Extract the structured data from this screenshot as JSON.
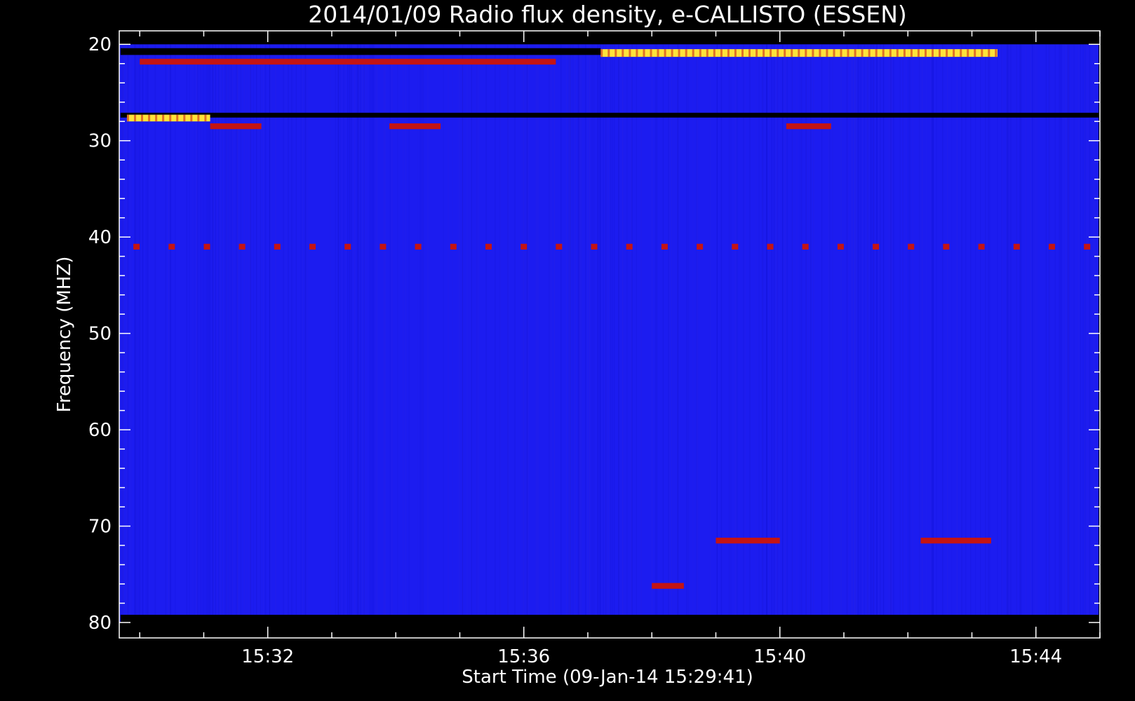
{
  "chart_data": {
    "type": "heatmap",
    "title": "2014/01/09  Radio flux density, e-CALLISTO (ESSEN)",
    "xlabel": "Start Time (09-Jan-14 15:29:41)",
    "ylabel": "Frequency (MHZ)",
    "x_ticks": [
      "15:32",
      "15:36",
      "15:40",
      "15:44"
    ],
    "x_tick_minutes": [
      32,
      36,
      40,
      44
    ],
    "x_range_minutes": [
      29.68,
      45.0
    ],
    "data_time_range_minutes": [
      29.68,
      44.98
    ],
    "y_ticks": [
      "20",
      "30",
      "40",
      "50",
      "60",
      "70",
      "80"
    ],
    "y_tick_values": [
      20,
      30,
      40,
      50,
      60,
      70,
      80
    ],
    "y_range": [
      18.6,
      81.6
    ],
    "y_reversed": true,
    "data_freq_range": [
      20,
      80
    ],
    "colors": {
      "background": "#000000",
      "axes": "#ffffff",
      "low": "#1c1cf0",
      "mid": "#c41414",
      "high": "#ffe33a",
      "dark": "#000000"
    },
    "features": [
      {
        "label": "intense emission band",
        "t0": 37.2,
        "t1": 43.4,
        "f0": 20.5,
        "f1": 21.3,
        "color": "high"
      },
      {
        "label": "emission band",
        "t0": 30.0,
        "t1": 36.5,
        "f0": 21.5,
        "f1": 22.1,
        "color": "mid"
      },
      {
        "label": "dark band",
        "t0": 29.7,
        "t1": 37.2,
        "f0": 20.4,
        "f1": 21.1,
        "color": "dark"
      },
      {
        "label": "interference band",
        "t0": 29.7,
        "t1": 45.0,
        "f0": 27.1,
        "f1": 27.6,
        "color": "dark"
      },
      {
        "label": "bright patch",
        "t0": 29.8,
        "t1": 31.1,
        "f0": 27.3,
        "f1": 28.0,
        "color": "high"
      },
      {
        "label": "emission patch",
        "t0": 31.1,
        "t1": 31.9,
        "f0": 28.2,
        "f1": 28.8,
        "color": "mid"
      },
      {
        "label": "emission patch",
        "t0": 33.9,
        "t1": 34.7,
        "f0": 28.2,
        "f1": 28.8,
        "color": "mid"
      },
      {
        "label": "emission patch",
        "t0": 40.1,
        "t1": 40.8,
        "f0": 28.2,
        "f1": 28.8,
        "color": "mid"
      },
      {
        "label": "periodic interference",
        "t0": 29.9,
        "t1": 45.0,
        "f0": 40.7,
        "f1": 41.3,
        "color": "mid"
      },
      {
        "label": "emission band",
        "t0": 39.0,
        "t1": 40.0,
        "f0": 71.2,
        "f1": 71.8,
        "color": "mid"
      },
      {
        "label": "emission band",
        "t0": 42.2,
        "t1": 43.3,
        "f0": 71.2,
        "f1": 71.8,
        "color": "mid"
      },
      {
        "label": "emission spot",
        "t0": 38.0,
        "t1": 38.5,
        "f0": 75.9,
        "f1": 76.5,
        "color": "mid"
      },
      {
        "label": "noise band",
        "t0": 29.7,
        "t1": 45.0,
        "f0": 79.2,
        "f1": 80.0,
        "color": "dark"
      }
    ]
  }
}
